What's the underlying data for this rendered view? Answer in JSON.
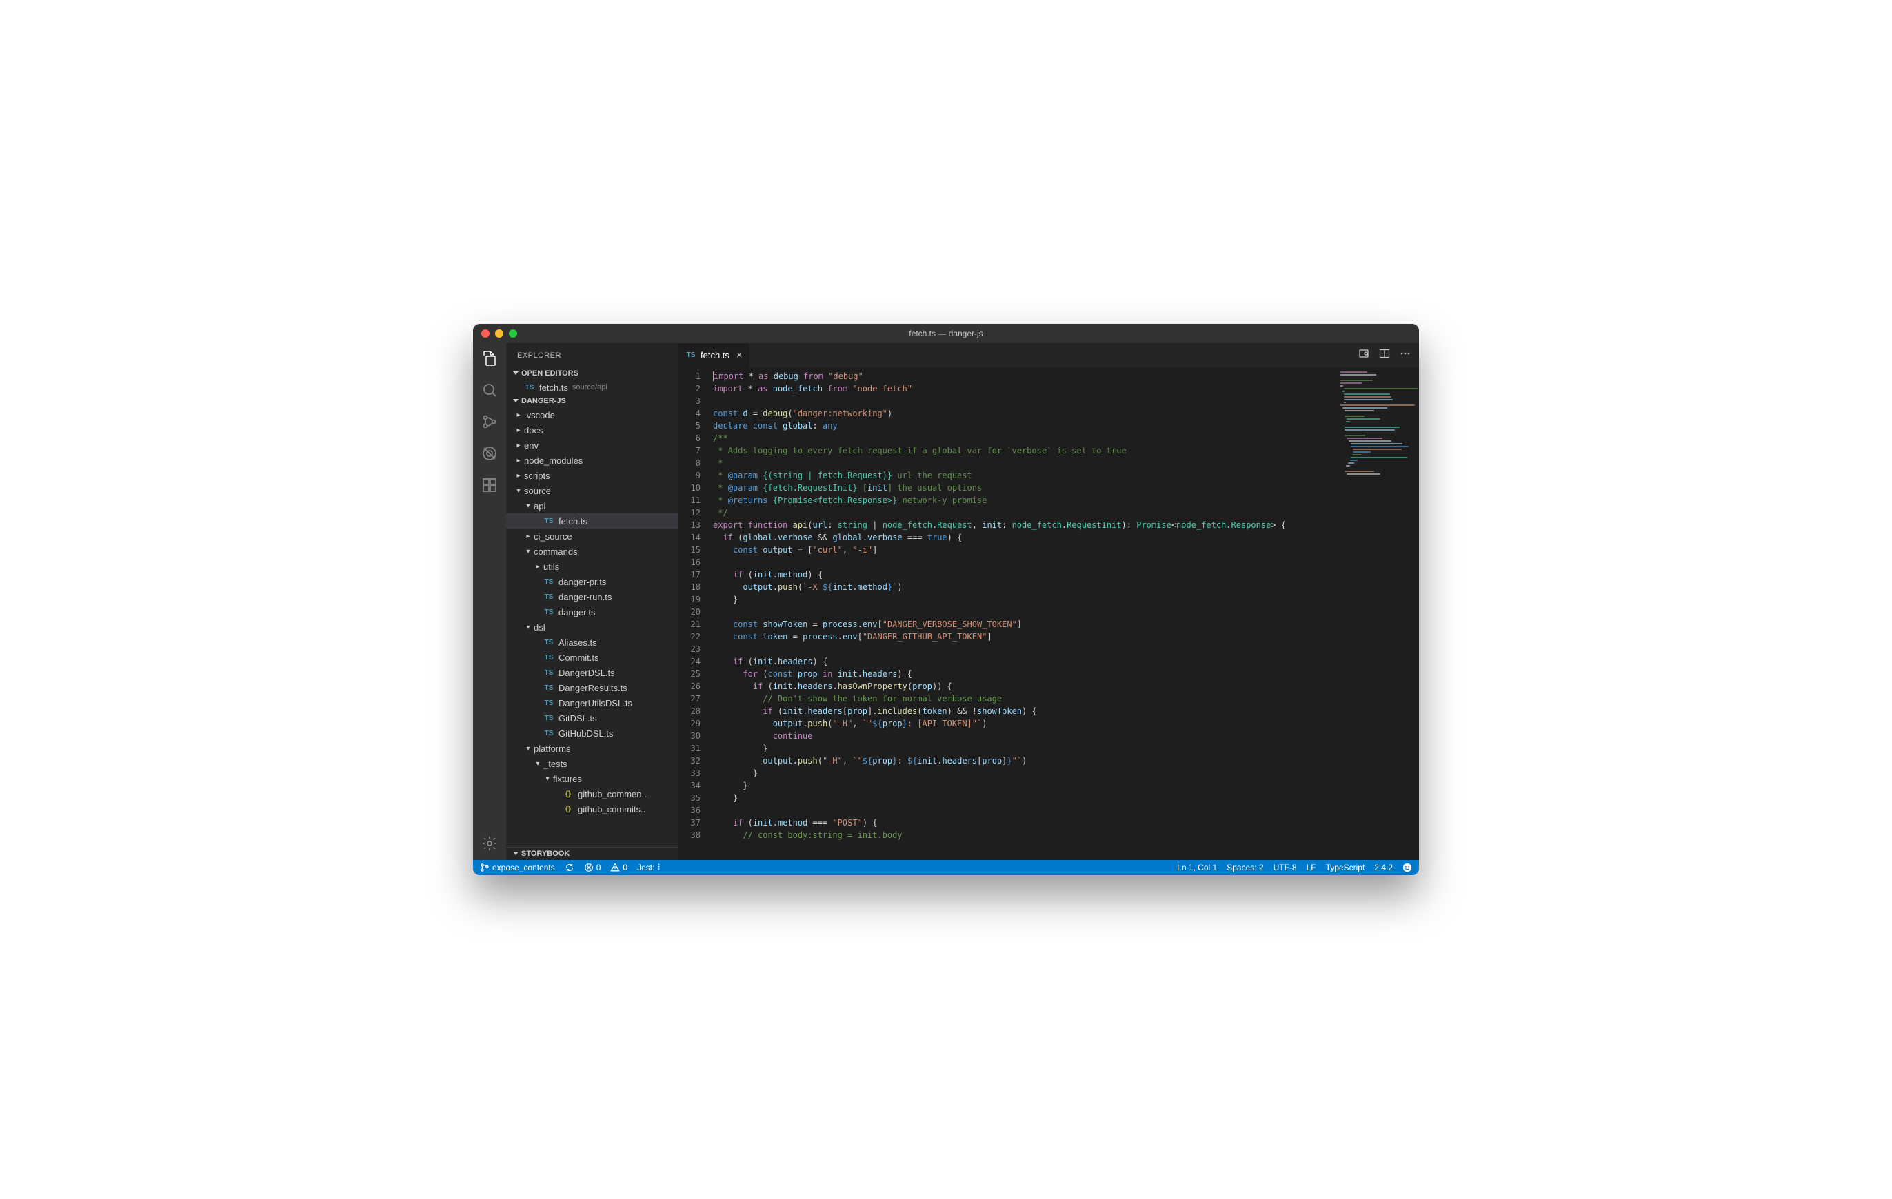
{
  "window": {
    "title": "fetch.ts — danger-js"
  },
  "activitybar": [
    "files",
    "search",
    "scm",
    "debug",
    "extensions"
  ],
  "sidebar": {
    "title": "EXPLORER",
    "openEditorsLabel": "OPEN EDITORS",
    "openEditors": [
      {
        "icon": "ts",
        "name": "fetch.ts",
        "path": "source/api"
      }
    ],
    "projectLabel": "DANGER-JS",
    "storybookLabel": "STORYBOOK",
    "tree": [
      {
        "d": 0,
        "t": "folder",
        "o": false,
        "n": ".vscode"
      },
      {
        "d": 0,
        "t": "folder",
        "o": false,
        "n": "docs"
      },
      {
        "d": 0,
        "t": "folder",
        "o": false,
        "n": "env"
      },
      {
        "d": 0,
        "t": "folder",
        "o": false,
        "n": "node_modules"
      },
      {
        "d": 0,
        "t": "folder",
        "o": false,
        "n": "scripts"
      },
      {
        "d": 0,
        "t": "folder",
        "o": true,
        "n": "source"
      },
      {
        "d": 1,
        "t": "folder",
        "o": true,
        "n": "api"
      },
      {
        "d": 2,
        "t": "ts",
        "n": "fetch.ts",
        "sel": true
      },
      {
        "d": 1,
        "t": "folder",
        "o": false,
        "n": "ci_source"
      },
      {
        "d": 1,
        "t": "folder",
        "o": true,
        "n": "commands"
      },
      {
        "d": 2,
        "t": "folder",
        "o": false,
        "n": "utils"
      },
      {
        "d": 2,
        "t": "ts",
        "n": "danger-pr.ts"
      },
      {
        "d": 2,
        "t": "ts",
        "n": "danger-run.ts"
      },
      {
        "d": 2,
        "t": "ts",
        "n": "danger.ts"
      },
      {
        "d": 1,
        "t": "folder",
        "o": true,
        "n": "dsl"
      },
      {
        "d": 2,
        "t": "ts",
        "n": "Aliases.ts"
      },
      {
        "d": 2,
        "t": "ts",
        "n": "Commit.ts"
      },
      {
        "d": 2,
        "t": "ts",
        "n": "DangerDSL.ts"
      },
      {
        "d": 2,
        "t": "ts",
        "n": "DangerResults.ts"
      },
      {
        "d": 2,
        "t": "ts",
        "n": "DangerUtilsDSL.ts"
      },
      {
        "d": 2,
        "t": "ts",
        "n": "GitDSL.ts"
      },
      {
        "d": 2,
        "t": "ts",
        "n": "GitHubDSL.ts"
      },
      {
        "d": 1,
        "t": "folder",
        "o": true,
        "n": "platforms"
      },
      {
        "d": 2,
        "t": "folder",
        "o": true,
        "n": "_tests"
      },
      {
        "d": 3,
        "t": "folder",
        "o": true,
        "n": "fixtures"
      },
      {
        "d": 4,
        "t": "js",
        "n": "github_commen.."
      },
      {
        "d": 4,
        "t": "js",
        "n": "github_commits.."
      }
    ]
  },
  "tab": {
    "icon": "ts",
    "name": "fetch.ts"
  },
  "code": {
    "lines": [
      [
        [
          "k",
          "import "
        ],
        [
          "p",
          "* "
        ],
        [
          "k",
          "as "
        ],
        [
          "v",
          "debug "
        ],
        [
          "k",
          "from "
        ],
        [
          "s",
          "\"debug\""
        ]
      ],
      [
        [
          "k",
          "import "
        ],
        [
          "p",
          "* "
        ],
        [
          "k",
          "as "
        ],
        [
          "v",
          "node_fetch "
        ],
        [
          "k",
          "from "
        ],
        [
          "s",
          "\"node-fetch\""
        ]
      ],
      [],
      [
        [
          "kw",
          "const "
        ],
        [
          "v",
          "d"
        ],
        [
          "p",
          " = "
        ],
        [
          "f",
          "debug"
        ],
        [
          "p",
          "("
        ],
        [
          "s",
          "\"danger:networking\""
        ],
        [
          "p",
          ")"
        ]
      ],
      [
        [
          "kw",
          "declare const "
        ],
        [
          "v",
          "global"
        ],
        [
          "p",
          ": "
        ],
        [
          "kw",
          "any"
        ]
      ],
      [
        [
          "c",
          "/**"
        ]
      ],
      [
        [
          "c",
          " * "
        ],
        [
          "cd",
          "Adds logging to every fetch request if a global var for `verbose` is set to true"
        ]
      ],
      [
        [
          "c",
          " *"
        ]
      ],
      [
        [
          "c",
          " * "
        ],
        [
          "kw",
          "@param"
        ],
        [
          "c",
          " "
        ],
        [
          "t",
          "{(string | fetch.Request)}"
        ],
        [
          "cd",
          " url the request"
        ]
      ],
      [
        [
          "c",
          " * "
        ],
        [
          "kw",
          "@param"
        ],
        [
          "c",
          " "
        ],
        [
          "t",
          "{fetch.RequestInit}"
        ],
        [
          "c",
          " ["
        ],
        [
          "v",
          "init"
        ],
        [
          "c",
          "]"
        ],
        [
          "cd",
          " the usual options"
        ]
      ],
      [
        [
          "c",
          " * "
        ],
        [
          "kw",
          "@returns"
        ],
        [
          "c",
          " "
        ],
        [
          "t",
          "{Promise<fetch.Response>}"
        ],
        [
          "cd",
          " network-y promise"
        ]
      ],
      [
        [
          "c",
          " */"
        ]
      ],
      [
        [
          "k",
          "export function "
        ],
        [
          "f",
          "api"
        ],
        [
          "p",
          "("
        ],
        [
          "v",
          "url"
        ],
        [
          "p",
          ": "
        ],
        [
          "t",
          "string"
        ],
        [
          "p",
          " | "
        ],
        [
          "t",
          "node_fetch"
        ],
        [
          "p",
          "."
        ],
        [
          "t",
          "Request"
        ],
        [
          "p",
          ", "
        ],
        [
          "v",
          "init"
        ],
        [
          "p",
          ": "
        ],
        [
          "t",
          "node_fetch"
        ],
        [
          "p",
          "."
        ],
        [
          "t",
          "RequestInit"
        ],
        [
          "p",
          "): "
        ],
        [
          "t",
          "Promise"
        ],
        [
          "p",
          "<"
        ],
        [
          "t",
          "node_fetch"
        ],
        [
          "p",
          "."
        ],
        [
          "t",
          "Response"
        ],
        [
          "p",
          "> {"
        ]
      ],
      [
        [
          "p",
          "  "
        ],
        [
          "k",
          "if "
        ],
        [
          "p",
          "("
        ],
        [
          "v",
          "global"
        ],
        [
          "p",
          "."
        ],
        [
          "v",
          "verbose"
        ],
        [
          "p",
          " && "
        ],
        [
          "v",
          "global"
        ],
        [
          "p",
          "."
        ],
        [
          "v",
          "verbose"
        ],
        [
          "p",
          " === "
        ],
        [
          "kw",
          "true"
        ],
        [
          "p",
          ") {"
        ]
      ],
      [
        [
          "p",
          "    "
        ],
        [
          "kw",
          "const "
        ],
        [
          "v",
          "output"
        ],
        [
          "p",
          " = ["
        ],
        [
          "s",
          "\"curl\""
        ],
        [
          "p",
          ", "
        ],
        [
          "s",
          "\"-i\""
        ],
        [
          "p",
          "]"
        ]
      ],
      [],
      [
        [
          "p",
          "    "
        ],
        [
          "k",
          "if "
        ],
        [
          "p",
          "("
        ],
        [
          "v",
          "init"
        ],
        [
          "p",
          "."
        ],
        [
          "v",
          "method"
        ],
        [
          "p",
          ") {"
        ]
      ],
      [
        [
          "p",
          "      "
        ],
        [
          "v",
          "output"
        ],
        [
          "p",
          "."
        ],
        [
          "f",
          "push"
        ],
        [
          "p",
          "("
        ],
        [
          "s",
          "`-X "
        ],
        [
          "kw",
          "${"
        ],
        [
          "v",
          "init"
        ],
        [
          "p",
          "."
        ],
        [
          "v",
          "method"
        ],
        [
          "kw",
          "}"
        ],
        [
          "s",
          "`"
        ],
        [
          "p",
          ")"
        ]
      ],
      [
        [
          "p",
          "    }"
        ]
      ],
      [],
      [
        [
          "p",
          "    "
        ],
        [
          "kw",
          "const "
        ],
        [
          "v",
          "showToken"
        ],
        [
          "p",
          " = "
        ],
        [
          "v",
          "process"
        ],
        [
          "p",
          "."
        ],
        [
          "v",
          "env"
        ],
        [
          "p",
          "["
        ],
        [
          "s",
          "\"DANGER_VERBOSE_SHOW_TOKEN\""
        ],
        [
          "p",
          "]"
        ]
      ],
      [
        [
          "p",
          "    "
        ],
        [
          "kw",
          "const "
        ],
        [
          "v",
          "token"
        ],
        [
          "p",
          " = "
        ],
        [
          "v",
          "process"
        ],
        [
          "p",
          "."
        ],
        [
          "v",
          "env"
        ],
        [
          "p",
          "["
        ],
        [
          "s",
          "\"DANGER_GITHUB_API_TOKEN\""
        ],
        [
          "p",
          "]"
        ]
      ],
      [],
      [
        [
          "p",
          "    "
        ],
        [
          "k",
          "if "
        ],
        [
          "p",
          "("
        ],
        [
          "v",
          "init"
        ],
        [
          "p",
          "."
        ],
        [
          "v",
          "headers"
        ],
        [
          "p",
          ") {"
        ]
      ],
      [
        [
          "p",
          "      "
        ],
        [
          "k",
          "for "
        ],
        [
          "p",
          "("
        ],
        [
          "kw",
          "const "
        ],
        [
          "v",
          "prop "
        ],
        [
          "k",
          "in "
        ],
        [
          "v",
          "init"
        ],
        [
          "p",
          "."
        ],
        [
          "v",
          "headers"
        ],
        [
          "p",
          ") {"
        ]
      ],
      [
        [
          "p",
          "        "
        ],
        [
          "k",
          "if "
        ],
        [
          "p",
          "("
        ],
        [
          "v",
          "init"
        ],
        [
          "p",
          "."
        ],
        [
          "v",
          "headers"
        ],
        [
          "p",
          "."
        ],
        [
          "f",
          "hasOwnProperty"
        ],
        [
          "p",
          "("
        ],
        [
          "v",
          "prop"
        ],
        [
          "p",
          ")) {"
        ]
      ],
      [
        [
          "p",
          "          "
        ],
        [
          "c",
          "// Don't show the token for normal verbose usage"
        ]
      ],
      [
        [
          "p",
          "          "
        ],
        [
          "k",
          "if "
        ],
        [
          "p",
          "("
        ],
        [
          "v",
          "init"
        ],
        [
          "p",
          "."
        ],
        [
          "v",
          "headers"
        ],
        [
          "p",
          "["
        ],
        [
          "v",
          "prop"
        ],
        [
          "p",
          "]."
        ],
        [
          "f",
          "includes"
        ],
        [
          "p",
          "("
        ],
        [
          "v",
          "token"
        ],
        [
          "p",
          ") && !"
        ],
        [
          "v",
          "showToken"
        ],
        [
          "p",
          ") {"
        ]
      ],
      [
        [
          "p",
          "            "
        ],
        [
          "v",
          "output"
        ],
        [
          "p",
          "."
        ],
        [
          "f",
          "push"
        ],
        [
          "p",
          "("
        ],
        [
          "s",
          "\"-H\""
        ],
        [
          "p",
          ", "
        ],
        [
          "s",
          "`\""
        ],
        [
          "kw",
          "${"
        ],
        [
          "v",
          "prop"
        ],
        [
          "kw",
          "}"
        ],
        [
          "s",
          ": [API TOKEN]\"`"
        ],
        [
          "p",
          ")"
        ]
      ],
      [
        [
          "p",
          "            "
        ],
        [
          "k",
          "continue"
        ]
      ],
      [
        [
          "p",
          "          }"
        ]
      ],
      [
        [
          "p",
          "          "
        ],
        [
          "v",
          "output"
        ],
        [
          "p",
          "."
        ],
        [
          "f",
          "push"
        ],
        [
          "p",
          "("
        ],
        [
          "s",
          "\"-H\""
        ],
        [
          "p",
          ", "
        ],
        [
          "s",
          "`\""
        ],
        [
          "kw",
          "${"
        ],
        [
          "v",
          "prop"
        ],
        [
          "kw",
          "}"
        ],
        [
          "s",
          ": "
        ],
        [
          "kw",
          "${"
        ],
        [
          "v",
          "init"
        ],
        [
          "p",
          "."
        ],
        [
          "v",
          "headers"
        ],
        [
          "p",
          "["
        ],
        [
          "v",
          "prop"
        ],
        [
          "p",
          "]"
        ],
        [
          "kw",
          "}"
        ],
        [
          "s",
          "\"`"
        ],
        [
          "p",
          ")"
        ]
      ],
      [
        [
          "p",
          "        }"
        ]
      ],
      [
        [
          "p",
          "      }"
        ]
      ],
      [
        [
          "p",
          "    }"
        ]
      ],
      [],
      [
        [
          "p",
          "    "
        ],
        [
          "k",
          "if "
        ],
        [
          "p",
          "("
        ],
        [
          "v",
          "init"
        ],
        [
          "p",
          "."
        ],
        [
          "v",
          "method"
        ],
        [
          "p",
          " === "
        ],
        [
          "s",
          "\"POST\""
        ],
        [
          "p",
          ") {"
        ]
      ],
      [
        [
          "p",
          "      "
        ],
        [
          "c",
          "// const body:string = init.body"
        ]
      ]
    ]
  },
  "status": {
    "branch": "expose_contents",
    "sync": "",
    "errors": "0",
    "warnings": "0",
    "jest": "Jest: ⠇",
    "cursor": "Ln 1, Col 1",
    "spaces": "Spaces: 2",
    "encoding": "UTF-8",
    "eol": "LF",
    "lang": "TypeScript",
    "version": "2.4.2"
  }
}
